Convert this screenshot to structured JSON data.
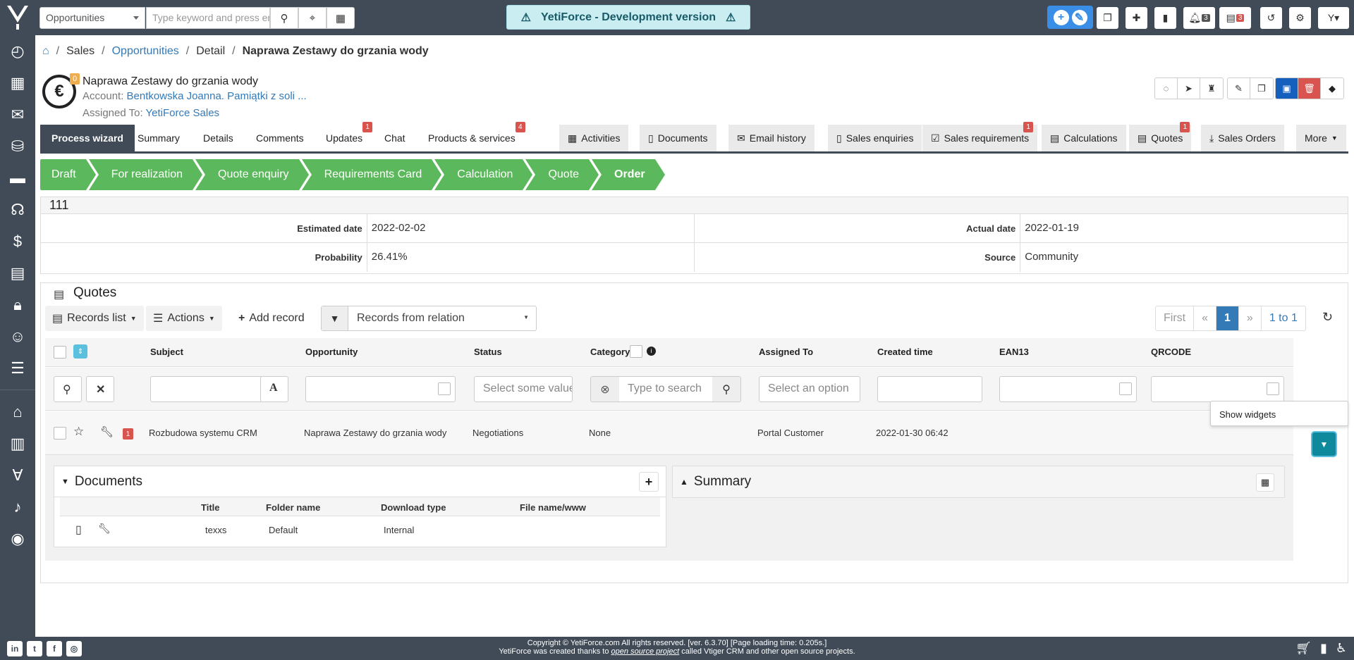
{
  "header": {
    "module_select": "Opportunities",
    "search_placeholder": "Type keyword and press enter",
    "dev_banner": "YetiForce - Development version",
    "notif_count": "3",
    "calendar_count": "3"
  },
  "breadcrumb": {
    "items": [
      "Sales",
      "Opportunities",
      "Detail"
    ],
    "current": "Naprawa Zestawy do grzania wody"
  },
  "record": {
    "badge": "0",
    "title": "Naprawa Zestawy do grzania wody",
    "account_label": "Account:",
    "account_value": "Bentkowska Joanna. Pamiątki z soli ...",
    "assigned_label": "Assigned To:",
    "assigned_value": "YetiForce Sales"
  },
  "tabs": {
    "left": [
      {
        "label": "Process wizard"
      },
      {
        "label": "Summary"
      },
      {
        "label": "Details"
      },
      {
        "label": "Comments"
      },
      {
        "label": "Updates",
        "badge": "1"
      },
      {
        "label": "Chat"
      },
      {
        "label": "Products & services",
        "badge": "4"
      }
    ],
    "right": [
      {
        "label": "Activities"
      },
      {
        "label": "Documents"
      },
      {
        "label": "Email history"
      },
      {
        "label": "Sales enquiries"
      },
      {
        "label": "Sales requirements",
        "badge": "1"
      },
      {
        "label": "Calculations"
      },
      {
        "label": "Quotes",
        "badge": "1"
      },
      {
        "label": "Sales Orders"
      }
    ],
    "more": "More"
  },
  "wizard": [
    "Draft",
    "For realization",
    "Quote enquiry",
    "Requirements Card",
    "Calculation",
    "Quote",
    "Order"
  ],
  "detail": {
    "header": "111",
    "estimated_date_label": "Estimated date",
    "estimated_date": "2022-02-02",
    "actual_date_label": "Actual date",
    "actual_date": "2022-01-19",
    "probability_label": "Probability",
    "probability": "26.41%",
    "source_label": "Source",
    "source": "Community"
  },
  "quotes": {
    "title": "Quotes",
    "records_list": "Records list",
    "actions": "Actions",
    "add_record": "Add record",
    "relation_filter": "Records from relation",
    "pager": {
      "first": "First",
      "prev": "«",
      "page": "1",
      "next": "»",
      "range": "1 to 1"
    },
    "columns": [
      "Subject",
      "Opportunity",
      "Status",
      "Category",
      "Assigned To",
      "Created time",
      "EAN13",
      "QRCODE"
    ],
    "filters": {
      "status_placeholder": "Select some values",
      "category_placeholder": "Type to search",
      "assigned_placeholder": "Select an option"
    },
    "row": {
      "badge": "1",
      "subject": "Rozbudowa systemu CRM",
      "opportunity": "Naprawa Zestawy do grzania wody",
      "status": "Negotiations",
      "category": "None",
      "assigned": "Portal Customer",
      "created": "2022-01-30 06:42"
    },
    "tooltip": "Show widgets"
  },
  "documents_widget": {
    "title": "Documents",
    "columns": [
      "Title",
      "Folder name",
      "Download type",
      "File name/www"
    ],
    "row": {
      "title": "texxs",
      "folder": "Default",
      "download": "Internal"
    }
  },
  "summary_widget": {
    "title": "Summary"
  },
  "footer": {
    "line1": "Copyright © YetiForce.com All rights reserved. [ver. 6.3.70] [Page loading time: 0.205s.]",
    "line2_prefix": "YetiForce was created thanks to",
    "line2_link": "open source project",
    "line2_suffix": "called Vtiger CRM and other open source projects."
  }
}
